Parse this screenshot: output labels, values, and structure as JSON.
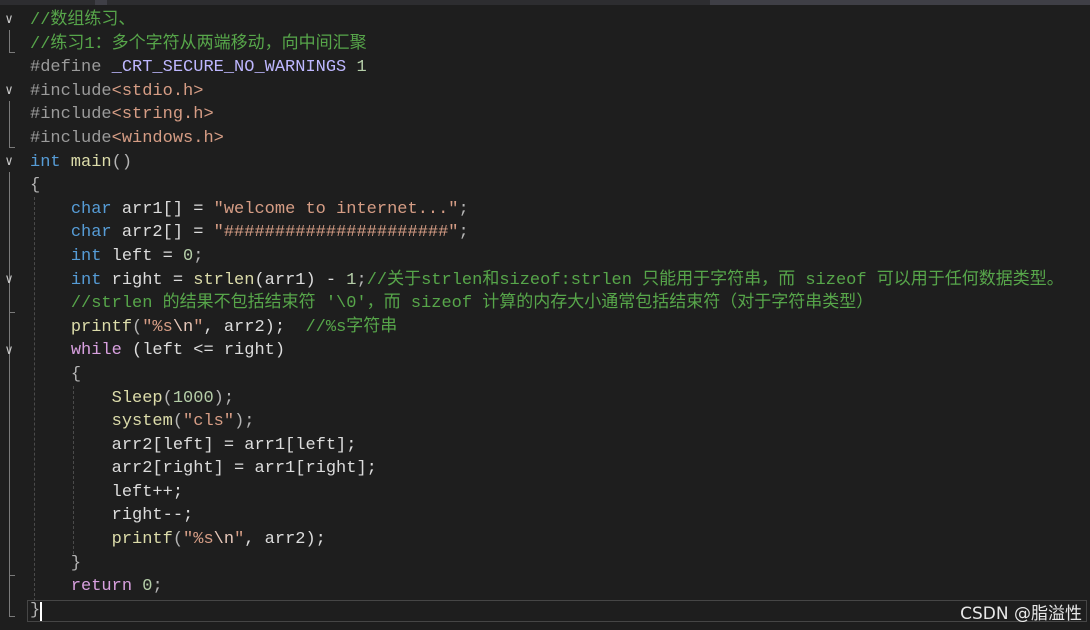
{
  "editor": {
    "language": "C",
    "lines": [
      [
        {
          "t": "//数组练习、",
          "c": "t-com"
        }
      ],
      [
        {
          "t": "//练习1：多个字符从两端移动，向中间汇聚",
          "c": "t-com"
        }
      ],
      [
        {
          "t": "#define ",
          "c": "t-pre"
        },
        {
          "t": "_CRT_SECURE_NO_WARNINGS",
          "c": "t-mac"
        },
        {
          "t": " ",
          "c": "t-id"
        },
        {
          "t": "1",
          "c": "t-num"
        }
      ],
      [
        {
          "t": "#include",
          "c": "t-pre"
        },
        {
          "t": "<stdio.h>",
          "c": "t-str"
        }
      ],
      [
        {
          "t": "#include",
          "c": "t-pre"
        },
        {
          "t": "<string.h>",
          "c": "t-str"
        }
      ],
      [
        {
          "t": "#include",
          "c": "t-pre"
        },
        {
          "t": "<windows.h>",
          "c": "t-str"
        }
      ],
      [
        {
          "t": "int",
          "c": "t-kw"
        },
        {
          "t": " main",
          "c": "t-fn"
        },
        {
          "t": "()",
          "c": "t-pun"
        }
      ],
      [
        {
          "t": "{",
          "c": "t-pun"
        }
      ],
      [
        {
          "t": "    ",
          "c": "t-id"
        },
        {
          "t": "char",
          "c": "t-kw"
        },
        {
          "t": " arr1[] = ",
          "c": "t-id"
        },
        {
          "t": "\"welcome to internet...\"",
          "c": "t-str"
        },
        {
          "t": ";",
          "c": "t-pun"
        }
      ],
      [
        {
          "t": "    ",
          "c": "t-id"
        },
        {
          "t": "char",
          "c": "t-kw"
        },
        {
          "t": " arr2[] = ",
          "c": "t-id"
        },
        {
          "t": "\"######################\"",
          "c": "t-str"
        },
        {
          "t": ";",
          "c": "t-pun"
        }
      ],
      [
        {
          "t": "    ",
          "c": "t-id"
        },
        {
          "t": "int",
          "c": "t-kw"
        },
        {
          "t": " left = ",
          "c": "t-id"
        },
        {
          "t": "0",
          "c": "t-num"
        },
        {
          "t": ";",
          "c": "t-pun"
        }
      ],
      [
        {
          "t": "    ",
          "c": "t-id"
        },
        {
          "t": "int",
          "c": "t-kw"
        },
        {
          "t": " right = ",
          "c": "t-id"
        },
        {
          "t": "strlen",
          "c": "t-fn"
        },
        {
          "t": "(arr1) - ",
          "c": "t-id"
        },
        {
          "t": "1",
          "c": "t-num"
        },
        {
          "t": ";",
          "c": "t-pun"
        },
        {
          "t": "//关于strlen和sizeof:strlen 只能用于字符串，而 sizeof 可以用于任何数据类型。",
          "c": "t-com"
        }
      ],
      [
        {
          "t": "    ",
          "c": "t-id"
        },
        {
          "t": "//strlen 的结果不包括结束符 '\\0'，而 sizeof 计算的内存大小通常包括结束符（对于字符串类型）",
          "c": "t-com"
        }
      ],
      [
        {
          "t": "    ",
          "c": "t-id"
        },
        {
          "t": "printf",
          "c": "t-fn"
        },
        {
          "t": "(",
          "c": "t-pun"
        },
        {
          "t": "\"%s",
          "c": "t-str"
        },
        {
          "t": "\\n",
          "c": "t-esc"
        },
        {
          "t": "\"",
          "c": "t-str"
        },
        {
          "t": ", arr2);  ",
          "c": "t-id"
        },
        {
          "t": "//%s字符串",
          "c": "t-com"
        }
      ],
      [
        {
          "t": "    ",
          "c": "t-id"
        },
        {
          "t": "while",
          "c": "t-ctl"
        },
        {
          "t": " (left <= right)",
          "c": "t-id"
        }
      ],
      [
        {
          "t": "    ",
          "c": "t-id"
        },
        {
          "t": "{",
          "c": "t-pun"
        }
      ],
      [
        {
          "t": "        ",
          "c": "t-id"
        },
        {
          "t": "Sleep",
          "c": "t-fn"
        },
        {
          "t": "(",
          "c": "t-pun"
        },
        {
          "t": "1000",
          "c": "t-num"
        },
        {
          "t": ");",
          "c": "t-pun"
        }
      ],
      [
        {
          "t": "        ",
          "c": "t-id"
        },
        {
          "t": "system",
          "c": "t-fn"
        },
        {
          "t": "(",
          "c": "t-pun"
        },
        {
          "t": "\"cls\"",
          "c": "t-str"
        },
        {
          "t": ");",
          "c": "t-pun"
        }
      ],
      [
        {
          "t": "        ",
          "c": "t-id"
        },
        {
          "t": "arr2[left] = arr1[left];",
          "c": "t-id"
        }
      ],
      [
        {
          "t": "        ",
          "c": "t-id"
        },
        {
          "t": "arr2[right] = arr1[right];",
          "c": "t-id"
        }
      ],
      [
        {
          "t": "        ",
          "c": "t-id"
        },
        {
          "t": "left++;",
          "c": "t-id"
        }
      ],
      [
        {
          "t": "        ",
          "c": "t-id"
        },
        {
          "t": "right--;",
          "c": "t-id"
        }
      ],
      [
        {
          "t": "        ",
          "c": "t-id"
        },
        {
          "t": "printf",
          "c": "t-fn"
        },
        {
          "t": "(",
          "c": "t-pun"
        },
        {
          "t": "\"%s",
          "c": "t-str"
        },
        {
          "t": "\\n",
          "c": "t-esc"
        },
        {
          "t": "\"",
          "c": "t-str"
        },
        {
          "t": ", arr2);",
          "c": "t-id"
        }
      ],
      [
        {
          "t": "    ",
          "c": "t-id"
        },
        {
          "t": "}",
          "c": "t-pun"
        }
      ],
      [
        {
          "t": "    ",
          "c": "t-id"
        },
        {
          "t": "return",
          "c": "t-ctl"
        },
        {
          "t": " ",
          "c": "t-id"
        },
        {
          "t": "0",
          "c": "t-num"
        },
        {
          "t": ";",
          "c": "t-pun"
        }
      ],
      [
        {
          "t": "}",
          "c": "t-pun"
        }
      ]
    ]
  },
  "watermark": "CSDN @脂溢性",
  "colors": {
    "background": "#1e1e1e",
    "comment": "#57a64a",
    "keyword": "#569cd6",
    "control": "#d8a0df",
    "string": "#d69d85",
    "number": "#b5cea8",
    "function": "#dcdcaa",
    "macro": "#beb7ff"
  }
}
